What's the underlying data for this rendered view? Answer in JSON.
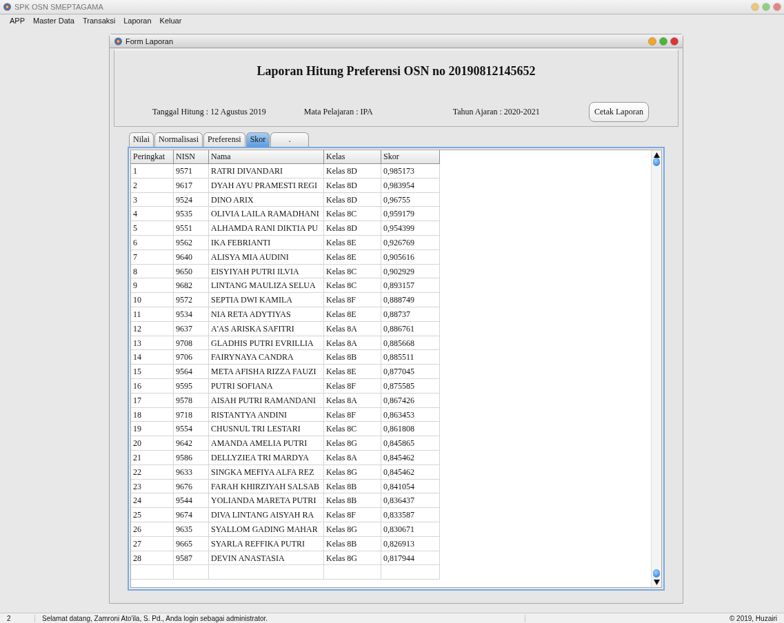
{
  "window": {
    "title": "SPK OSN SMEPTAGAMA"
  },
  "menu": [
    "APP",
    "Master Data",
    "Transaksi",
    "Laporan",
    "Keluar"
  ],
  "form": {
    "title": "Form Laporan",
    "report_title": "Laporan Hitung Preferensi OSN no 20190812145652",
    "info": [
      "Tanggal Hitung : 12 Agustus 2019",
      "Mata Pelajaran : IPA",
      "Tahun Ajaran : 2020-2021"
    ],
    "print_button": "Cetak Laporan",
    "tabs": [
      {
        "label": "Nilai",
        "selected": false
      },
      {
        "label": "Normalisasi",
        "selected": false
      },
      {
        "label": "Preferensi",
        "selected": false
      },
      {
        "label": "Skor",
        "selected": true
      },
      {
        "label": ".",
        "selected": false
      }
    ],
    "table": {
      "columns": [
        "Peringkat",
        "NISN",
        "Nama",
        "Kelas",
        "Skor"
      ],
      "rows": [
        [
          "1",
          "9571",
          "RATRI DIVANDARI",
          "Kelas 8D",
          "0,985173"
        ],
        [
          "2",
          "9617",
          "DYAH AYU PRAMESTI REGI",
          "Kelas 8D",
          "0,983954"
        ],
        [
          "3",
          "9524",
          "DINO ARIX",
          "Kelas 8D",
          "0,96755"
        ],
        [
          "4",
          "9535",
          "OLIVIA LAILA RAMADHANI",
          "Kelas 8C",
          "0,959179"
        ],
        [
          "5",
          "9551",
          "ALHAMDA RANI DIKTIA PU",
          "Kelas 8D",
          "0,954399"
        ],
        [
          "6",
          "9562",
          "IKA FEBRIANTI",
          "Kelas 8E",
          "0,926769"
        ],
        [
          "7",
          "9640",
          "ALISYA MIA AUDINI",
          "Kelas 8E",
          "0,905616"
        ],
        [
          "8",
          "9650",
          "EISYIYAH PUTRI ILVIA",
          "Kelas 8C",
          "0,902929"
        ],
        [
          "9",
          "9682",
          "LINTANG MAULIZA SELUA",
          "Kelas 8C",
          "0,893157"
        ],
        [
          "10",
          "9572",
          "SEPTIA DWI KAMILA",
          "Kelas 8F",
          "0,888749"
        ],
        [
          "11",
          "9534",
          "NIA RETA ADYTIYAS",
          "Kelas 8E",
          "0,88737"
        ],
        [
          "12",
          "9637",
          "A'AS ARISKA SAFITRI",
          "Kelas 8A",
          "0,886761"
        ],
        [
          "13",
          "9708",
          "GLADHIS PUTRI EVRILLIA",
          "Kelas 8A",
          "0,885668"
        ],
        [
          "14",
          "9706",
          "FAIRYNAYA CANDRA",
          "Kelas 8B",
          "0,885511"
        ],
        [
          "15",
          "9564",
          "META AFISHA RIZZA FAUZI",
          "Kelas 8E",
          "0,877045"
        ],
        [
          "16",
          "9595",
          "PUTRI SOFIANA",
          "Kelas 8F",
          "0,875585"
        ],
        [
          "17",
          "9578",
          "AISAH PUTRI RAMANDANI",
          "Kelas 8A",
          "0,867426"
        ],
        [
          "18",
          "9718",
          "RISTANTYA ANDINI",
          "Kelas 8F",
          "0,863453"
        ],
        [
          "19",
          "9554",
          "CHUSNUL TRI LESTARI",
          "Kelas 8C",
          "0,861808"
        ],
        [
          "20",
          "9642",
          "AMANDA AMELIA PUTRI",
          "Kelas 8G",
          "0,845865"
        ],
        [
          "21",
          "9586",
          "DELLYZIEA TRI MARDYA",
          "Kelas 8A",
          "0,845462"
        ],
        [
          "22",
          "9633",
          "SINGKA MEFIYA ALFA REZ",
          "Kelas 8G",
          "0,845462"
        ],
        [
          "23",
          "9676",
          "FARAH KHIRZIYAH SALSAB",
          "Kelas 8B",
          "0,841054"
        ],
        [
          "24",
          "9544",
          "YOLIANDA MARETA PUTRI",
          "Kelas 8B",
          "0,836437"
        ],
        [
          "25",
          "9674",
          "DIVA LINTANG AISYAH RA",
          "Kelas 8F",
          "0,833587"
        ],
        [
          "26",
          "9635",
          "SYALLOM GADING MAHAR",
          "Kelas 8G",
          "0,830671"
        ],
        [
          "27",
          "9665",
          "SYARLA REFFIKA PUTRI",
          "Kelas 8B",
          "0,826913"
        ],
        [
          "28",
          "9587",
          "DEVIN ANASTASIA",
          "Kelas 8G",
          "0,817944"
        ]
      ]
    }
  },
  "status_bar": {
    "number": "2",
    "message": "Selamat datang, Zamroni Ato'ila, S. Pd., Anda login sebagai administrator.",
    "copyright": "© 2019, Huzairi"
  }
}
